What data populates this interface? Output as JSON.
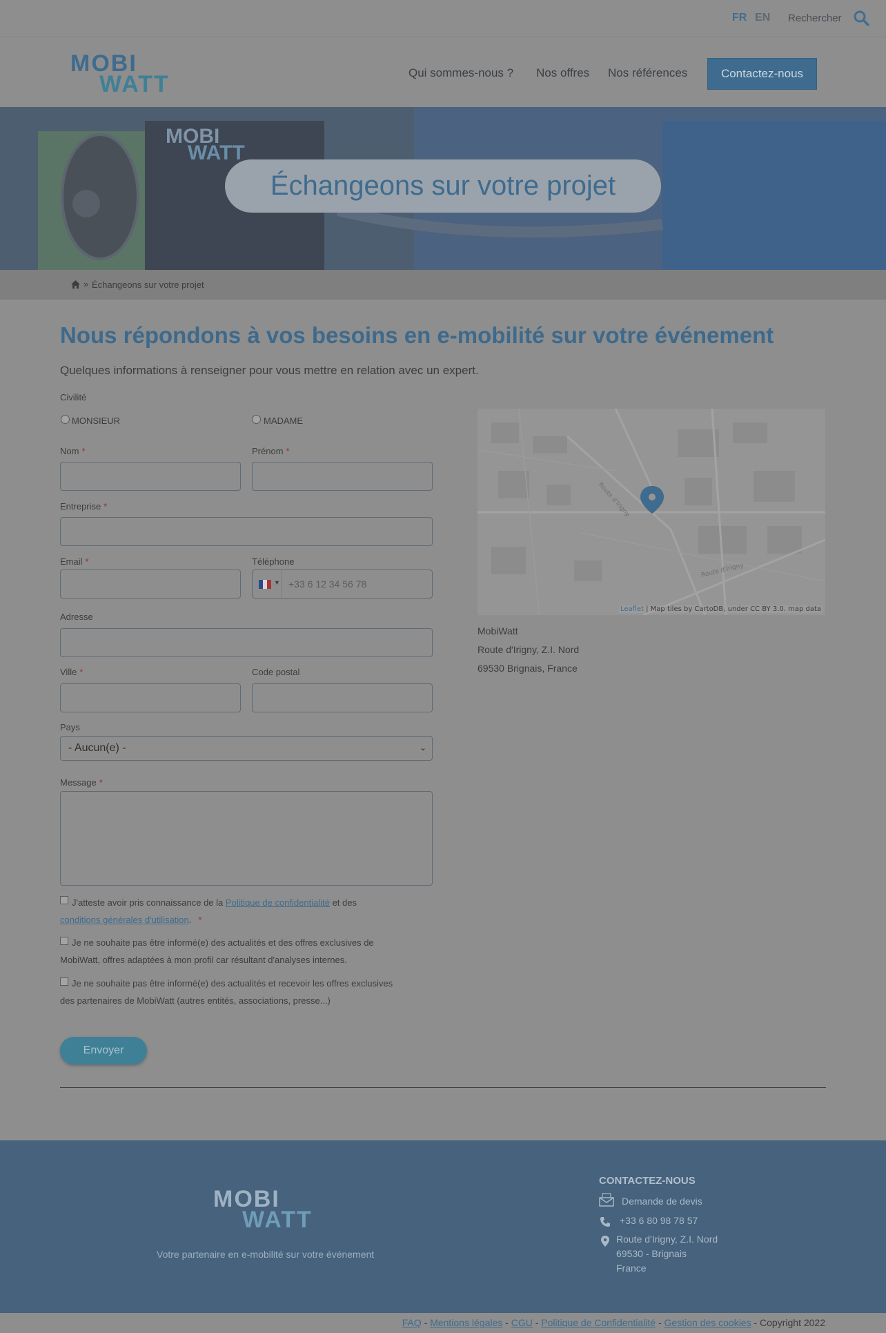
{
  "topbar": {
    "lang_fr": "FR",
    "lang_en": "EN",
    "search_label": "Rechercher"
  },
  "header": {
    "nav": [
      "Qui sommes-nous ?",
      "Nos offres",
      "Nos références"
    ],
    "cta": "Contactez-nous",
    "brand_color": "#3e6b8e"
  },
  "hero": {
    "title": "Échangeons sur votre projet"
  },
  "breadcrumb": {
    "separator": "»",
    "current": "Échangeons sur votre projet"
  },
  "main": {
    "heading": "Nous répondons à vos besoins en e-mobilité sur votre événement",
    "intro": "Quelques informations à renseigner pour vous mettre en relation avec un expert."
  },
  "form": {
    "civilite_label": "Civilité",
    "civilite_options": [
      "MONSIEUR",
      "MADAME"
    ],
    "required_mark": "*",
    "nom": "Nom",
    "prenom": "Prénom",
    "entreprise": "Entreprise",
    "email": "Email",
    "telephone": "Téléphone",
    "telephone_placeholder": "+33 6 12 34 56 78",
    "adresse": "Adresse",
    "ville": "Ville",
    "code_postal": "Code postal",
    "pays": "Pays",
    "pays_value": "- Aucun(e) -",
    "message": "Message",
    "consent1_a": "J'atteste avoir pris connaissance de la ",
    "consent1_link1": "Politique de confidentialité",
    "consent1_b": " et des",
    "consent1_link2": "conditions générales d'utilisation",
    "consent1_c": ".",
    "consent2_line1": "Je ne souhaite pas être informé(e) des actualités et des offres exclusives de",
    "consent2_line2": "MobiWatt, offres adaptées à mon profil car résultant d'analyses internes.",
    "consent3_line1": "Je ne souhaite pas être informé(e) des actualités et recevoir les offres exclusives",
    "consent3_line2": "des partenaires de MobiWatt (autres entités, associations, presse...)",
    "submit": "Envoyer"
  },
  "map": {
    "attribution_link": "Leaflet",
    "attribution_text": " | Map tiles by CartoDB, under CC BY 3.0. map data",
    "road1": "Route d'Irigny",
    "road2": "Route d'Irigny"
  },
  "address": {
    "name": "MobiWatt",
    "line1": "Route d'Irigny, Z.I. Nord",
    "line2": "69530 Brignais, France"
  },
  "footer": {
    "tagline": "Votre partenaire en e-mobilité sur votre événement",
    "contact_title": "CONTACTEZ-NOUS",
    "quote": "Demande de devis",
    "phone": "+33 6 80 98 78 57",
    "addr1": "Route d'Irigny, Z.I. Nord",
    "addr2": "69530  - Brignais",
    "addr3": "France"
  },
  "bottom": {
    "links": [
      "FAQ",
      "Mentions légales",
      "CGU",
      "Politique de Confidentialité",
      "Gestion des cookies"
    ],
    "separator": " - ",
    "copyright": " - Copyright 2022"
  },
  "logo": {
    "line1": "MOBI",
    "line2": "WATT"
  }
}
